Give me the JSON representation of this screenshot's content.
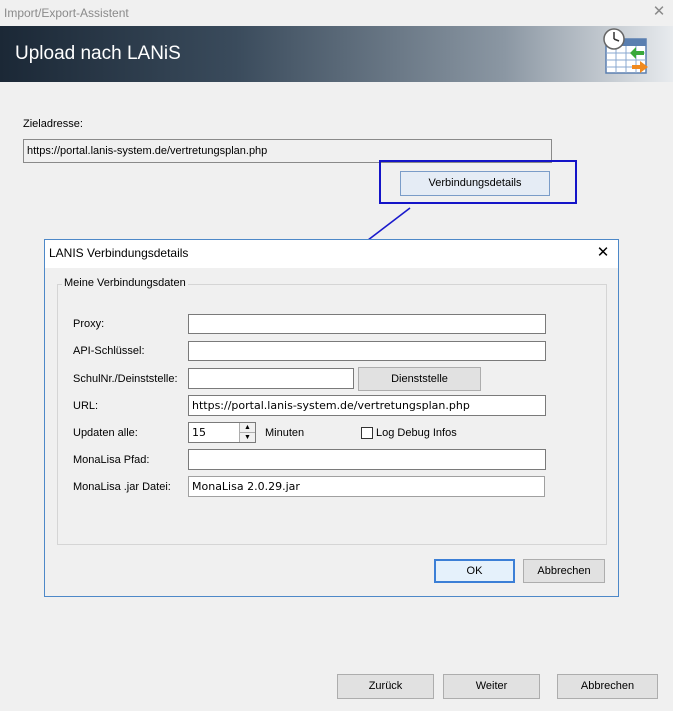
{
  "window": {
    "title": "Import/Export-Assistent",
    "close_glyph": "✕"
  },
  "banner": {
    "title": "Upload nach LANiS",
    "icon": "calendar-clock-export-icon"
  },
  "main": {
    "target_label": "Zieladresse:",
    "target_value": "https://portal.lanis-system.de/vertretungsplan.php",
    "details_button": "Verbindungsdetails"
  },
  "dialog": {
    "title": "LANIS Verbindungsdetails",
    "close_glyph": "✕",
    "group_title": "Meine Verbindungsdaten",
    "fields": {
      "proxy_label": "Proxy:",
      "proxy_value": "",
      "api_label": "API-Schlüssel:",
      "api_value": "",
      "school_label": "SchulNr./Deinststelle:",
      "school_value": "",
      "school_button": "Dienststelle",
      "url_label": "URL:",
      "url_value": "https://portal.lanis-system.de/vertretungsplan.php",
      "update_label": "Updaten alle:",
      "update_value": "15",
      "update_unit": "Minuten",
      "debug_label": "Log Debug Infos",
      "debug_checked": false,
      "monalisa_path_label": "MonaLisa Pfad:",
      "monalisa_path_value": "",
      "monalisa_jar_label": "MonaLisa .jar Datei:",
      "monalisa_jar_value": "MonaLisa 2.0.29.jar"
    },
    "ok_button": "OK",
    "cancel_button": "Abbrechen"
  },
  "footer": {
    "back_button": "Zurück",
    "next_button": "Weiter",
    "cancel_button": "Abbrechen"
  },
  "colors": {
    "highlight": "#1414c8",
    "arrow": "#1a1acc",
    "dialog_border": "#4d88c8"
  }
}
